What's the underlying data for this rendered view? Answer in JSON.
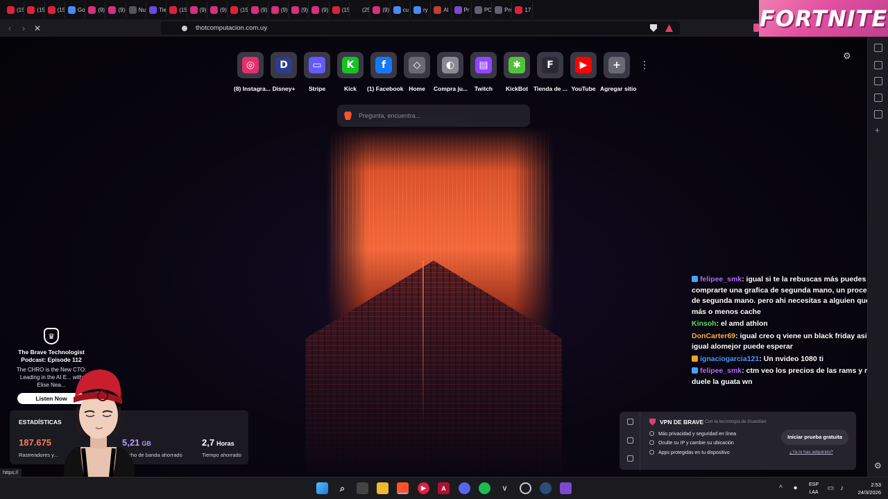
{
  "tabs": [
    {
      "title": "(15",
      "color": "#e0203a"
    },
    {
      "title": "(15",
      "color": "#e0203a"
    },
    {
      "title": "(15",
      "color": "#e0203a"
    },
    {
      "title": "Go",
      "color": "#4a8af4"
    },
    {
      "title": "(9)",
      "color": "#d6307c"
    },
    {
      "title": "(9)",
      "color": "#d6307c"
    },
    {
      "title": "Nu",
      "color": "#555560"
    },
    {
      "title": "Tie",
      "color": "#6a4ae0"
    },
    {
      "title": "(15",
      "color": "#e0203a"
    },
    {
      "title": "(9)",
      "color": "#d6307c"
    },
    {
      "title": "(9)",
      "color": "#d6307c"
    },
    {
      "title": "(15",
      "color": "#e0203a"
    },
    {
      "title": "(9)",
      "color": "#d6307c"
    },
    {
      "title": "(9)",
      "color": "#d6307c"
    },
    {
      "title": "(9)",
      "color": "#d6307c"
    },
    {
      "title": "(9)",
      "color": "#d6307c"
    },
    {
      "title": "(15",
      "color": "#e0203a"
    },
    {
      "title": "(25",
      "color": "#111111"
    },
    {
      "title": "(9)",
      "color": "#d6307c"
    },
    {
      "title": "cu",
      "color": "#4a8af4"
    },
    {
      "title": "ry",
      "color": "#4a8af4"
    },
    {
      "title": "Al",
      "color": "#c04030"
    },
    {
      "title": "Pr",
      "color": "#7a4ad0"
    },
    {
      "title": "PC",
      "color": "#606070"
    },
    {
      "title": "Pro",
      "color": "#606070"
    },
    {
      "title": "17",
      "color": "#e0203a"
    }
  ],
  "banner": {
    "text": "FORTNITE"
  },
  "address_bar": {
    "url": "thotcomputacion.com.uy"
  },
  "top_sites": [
    {
      "label": "(8) Instagra...",
      "glyph": "◎",
      "color": "#e1306c"
    },
    {
      "label": "Disney+",
      "glyph": "D",
      "color": "#2a3c8a"
    },
    {
      "label": "Stripe",
      "glyph": "▭",
      "color": "#635bff"
    },
    {
      "label": "Kick",
      "glyph": "K",
      "color": "#16c224"
    },
    {
      "label": "(1) Facebook",
      "glyph": "f",
      "color": "#1877f2"
    },
    {
      "label": "Home",
      "glyph": "◇",
      "color": "#6a6a74"
    },
    {
      "label": "Compra ju...",
      "glyph": "◐",
      "color": "#8a8a94"
    },
    {
      "label": "Twitch",
      "glyph": "▤",
      "color": "#9146ff"
    },
    {
      "label": "KickBot",
      "glyph": "✱",
      "color": "#53c23a"
    },
    {
      "label": "Tienda de ...",
      "glyph": "F",
      "color": "#2a2a34"
    },
    {
      "label": "YouTube",
      "glyph": "▶",
      "color": "#ff0000"
    },
    {
      "label": "Agregar sitio",
      "glyph": "+",
      "color": "#6a6a74"
    }
  ],
  "search": {
    "placeholder": "Pregunta, encuentra..."
  },
  "chat": [
    {
      "user": "felipee_smk",
      "user_color": "#b46cff",
      "badge": "#4aa0ff",
      "text": ": igual si te la rebuscas más puedes comprarte una grafica de segunda mano, un proce de segunda mano. pero ahi necesitas a alguien que más o menos cache"
    },
    {
      "user": "Kinsoh",
      "user_color": "#5ee05e",
      "badge": "",
      "text": ": el amd athlon"
    },
    {
      "user": "DonCarter69",
      "user_color": "#ffb347",
      "badge": "",
      "text": ": igual creo q viene un black friday asi q igual alomejor puede esperar"
    },
    {
      "user": "ignaciogarcia121",
      "user_color": "#4a9aff",
      "badge": "#f0a020",
      "text": ": Un nvideo 1080 ti"
    },
    {
      "user": "felipee_smk",
      "user_color": "#b46cff",
      "badge": "#4aa0ff",
      "text": ": ctm veo los precios de las rams y me duele la guata wn"
    }
  ],
  "podcast": {
    "title": "The Brave Technologist Podcast: Episode 112",
    "desc": "The CHRO is the New CTO: Leading in the AI E... with Elise Nea...",
    "button": "Listen Now"
  },
  "stats": {
    "title": "ESTADÍSTICAS",
    "items": [
      {
        "value": "187.675",
        "unit": "",
        "label": "Rastreadores y...",
        "color": "#ff7a59"
      },
      {
        "value": "5,21",
        "unit": "GB",
        "label": "Ancho de banda ahorrado",
        "color": "#b49cff"
      },
      {
        "value": "2,7",
        "unit": "Horas",
        "label": "Tiempo ahorrado",
        "color": "#ffffff"
      }
    ]
  },
  "vpn": {
    "title": "VPN DE BRAVE",
    "subtitle": "Con la tecnología de Guardian",
    "items": [
      "Más privacidad y seguridad en línea",
      "Oculte su IP y cambie su ubicación",
      "Apps protegidas en tu dispositivo"
    ],
    "cta": "Iniciar prueba gratuita",
    "link": "¿Ya lo has adquirido?"
  },
  "status_url": "https://",
  "taskbar": {
    "lang_line1": "ESP",
    "lang_line2": "LAA",
    "time": "2:53",
    "date": "24/3/2026"
  }
}
